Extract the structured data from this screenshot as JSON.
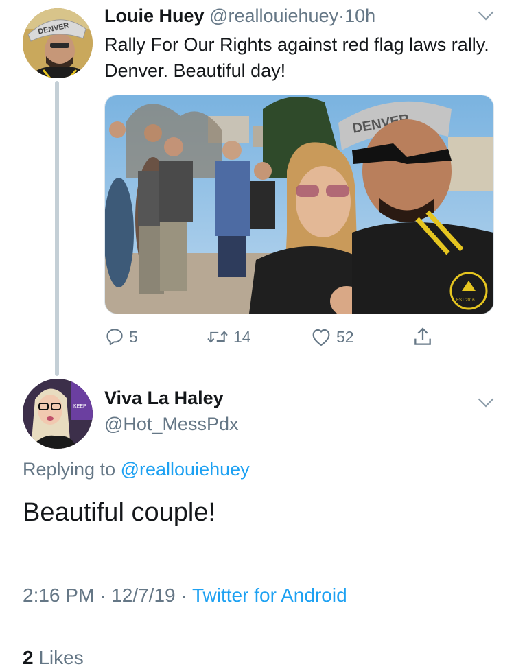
{
  "tweet": {
    "author_name": "Louie Huey",
    "author_handle": "@reallouiehuey",
    "separator": "·",
    "time_ago": "10h",
    "text": "Rally For Our Rights against red flag laws rally. Denver. Beautiful day!",
    "avatar_cap_text": "DENVER",
    "photo_cap_text": "DENVER",
    "photo_patch_text": "EST 2016",
    "actions": {
      "reply_count": "5",
      "retweet_count": "14",
      "like_count": "52"
    }
  },
  "reply": {
    "author_name": "Viva La Haley",
    "author_handle": "@Hot_MessPdx",
    "avatar_sign_text": "KEEP",
    "replying_prefix": "Replying to",
    "replying_to": "@reallouiehuey",
    "text": "Beautiful couple!",
    "time": "2:16 PM",
    "separator": "·",
    "date": "12/7/19",
    "source": "Twitter for Android",
    "likes_count": "2",
    "likes_label": "Likes"
  },
  "colors": {
    "link": "#1da1f2",
    "muted": "#657786",
    "text": "#14171a",
    "line": "#c4cfd6"
  },
  "icons": [
    "reply-icon",
    "retweet-icon",
    "like-icon",
    "share-icon",
    "chevron-down-icon"
  ]
}
